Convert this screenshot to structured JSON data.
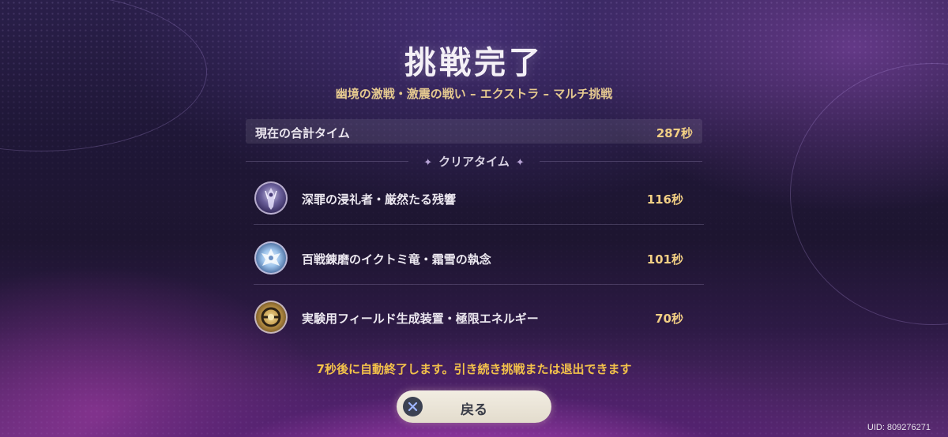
{
  "result": {
    "title": "挑戦完了",
    "subtitle": "幽境の激戦・激震の戦い – エクストラ – マルチ挑戦"
  },
  "total": {
    "label": "現在の合計タイム",
    "value": "287秒"
  },
  "clear_times": {
    "heading": "クリアタイム",
    "bosses": [
      {
        "name": "深罪の浸礼者・厳然たる残響",
        "time": "116秒",
        "icon": "sinister-baptist-icon"
      },
      {
        "name": "百戦錬磨のイクトミ竜・霜雪の執念",
        "time": "101秒",
        "icon": "ice-dragon-icon"
      },
      {
        "name": "実験用フィールド生成装置・極限エネルギー",
        "time": "70秒",
        "icon": "field-generator-icon"
      }
    ]
  },
  "notice": "7秒後に自動終了します。引き続き挑戦または退出できます",
  "back_button": {
    "label": "戻る",
    "icon": "cross-button-icon"
  },
  "uid": "UID: 809276271",
  "colors": {
    "accent_gold": "#f2cf84",
    "notice_yellow": "#f2c14a",
    "subtitle_gold": "#e5c98f",
    "button_bg": "#ede7da"
  }
}
